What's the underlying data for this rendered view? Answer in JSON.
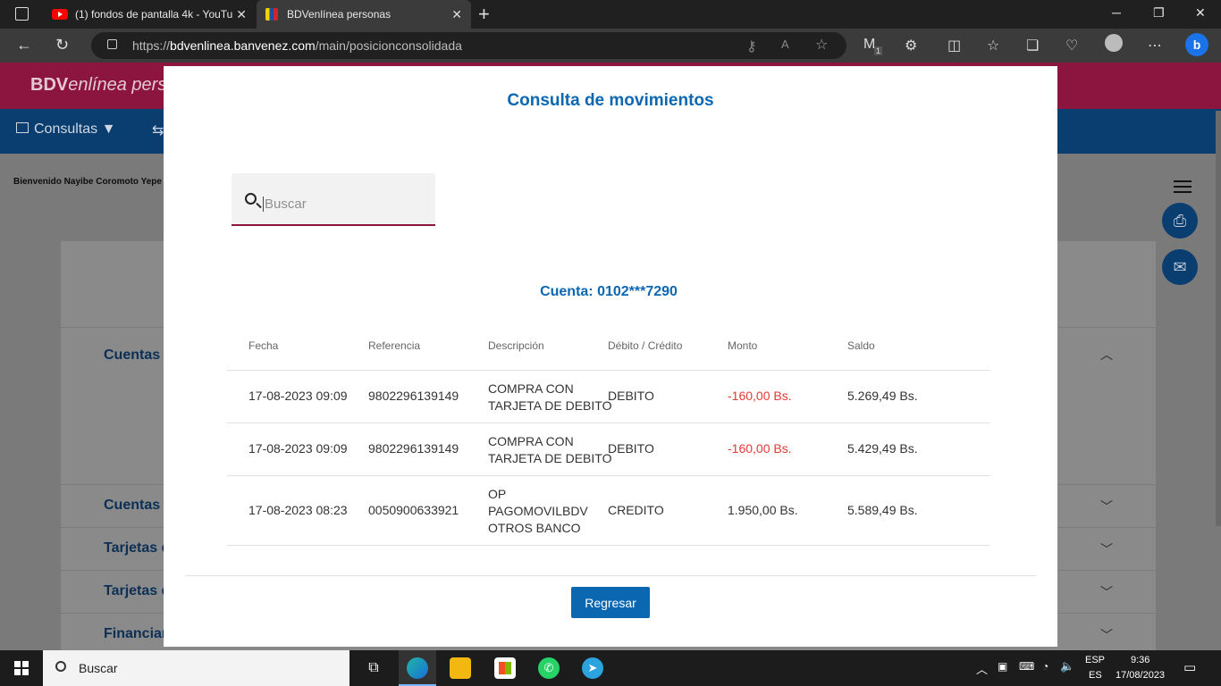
{
  "browser": {
    "tabs": [
      {
        "title": "(1) fondos de pantalla 4k - YouTu",
        "close": "✕"
      },
      {
        "title": "BDVenlínea personas",
        "close": "✕"
      }
    ],
    "url_prefix": "https://",
    "url_host": "bdvenlinea.banvenez.com",
    "url_path": "/main/posicionconsolidada",
    "extension_badge": "1"
  },
  "site": {
    "logo_bold": "BDV",
    "logo_rest": "enlínea pers",
    "nav_consultas": "Consultas ▼",
    "welcome": "Bienvenido Nayibe Coromoto Yepe",
    "sections": [
      "Cuentas",
      "Cuentas n",
      "Tarjetas d",
      "Tarjetas d",
      "Financian"
    ]
  },
  "modal": {
    "title": "Consulta de movimientos",
    "search_placeholder": "Buscar",
    "account": "Cuenta: 0102***7290",
    "columns": [
      "Fecha",
      "Referencia",
      "Descripción",
      "Débito / Crédito",
      "Monto",
      "Saldo"
    ],
    "rows": [
      {
        "fecha": "17-08-2023 09:09",
        "referencia": "9802296139149",
        "descripcion": [
          "COMPRA CON",
          "TARJETA DE DEBITO"
        ],
        "tipo": "DEBITO",
        "monto": "-160,00 Bs.",
        "saldo": "5.269,49 Bs."
      },
      {
        "fecha": "17-08-2023 09:09",
        "referencia": "9802296139149",
        "descripcion": [
          "COMPRA CON",
          "TARJETA DE DEBITO"
        ],
        "tipo": "DEBITO",
        "monto": "-160,00 Bs.",
        "saldo": "5.429,49 Bs."
      },
      {
        "fecha": "17-08-2023 08:23",
        "referencia": "0050900633921",
        "descripcion": [
          "OP",
          "PAGOMOVILBDV",
          "OTROS BANCO"
        ],
        "tipo": "CREDITO",
        "monto": "1.950,00 Bs.",
        "saldo": "5.589,49 Bs."
      }
    ],
    "back_button": "Regresar"
  },
  "taskbar": {
    "search_placeholder": "Buscar",
    "lang_top": "ESP",
    "lang_bottom": "ES",
    "time": "9:36",
    "date": "17/08/2023"
  },
  "colors": {
    "brand_red": "#8c1540",
    "brand_blue": "#0c67b1",
    "negative": "#e53935"
  }
}
